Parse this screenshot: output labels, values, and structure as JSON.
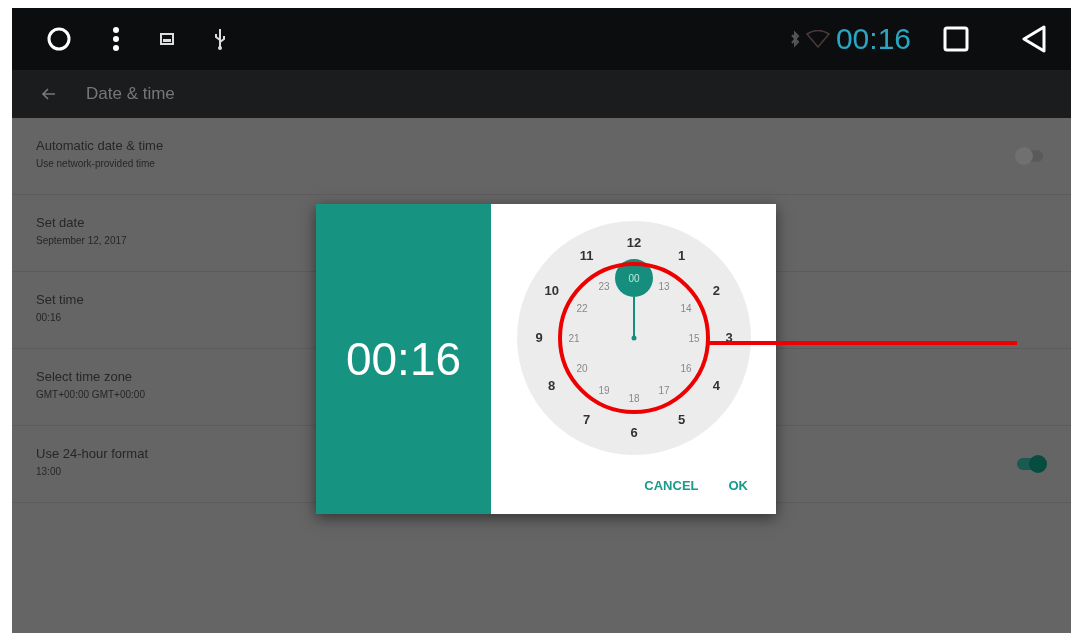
{
  "status_bar": {
    "time": "00:16"
  },
  "toolbar": {
    "title": "Date & time"
  },
  "settings": [
    {
      "title": "Automatic date & time",
      "subtitle": "Use network-provided time",
      "kind": "switch",
      "on": false
    },
    {
      "title": "Set date",
      "subtitle": "September 12, 2017",
      "kind": "plain"
    },
    {
      "title": "Set time",
      "subtitle": "00:16",
      "kind": "plain"
    },
    {
      "title": "Select time zone",
      "subtitle": "GMT+00:00 GMT+00:00",
      "kind": "plain"
    },
    {
      "title": "Use 24-hour format",
      "subtitle": "13:00",
      "kind": "switch",
      "on": true
    }
  ],
  "dialog": {
    "time": "00:16",
    "outer": [
      {
        "label": "12",
        "selected": false
      },
      {
        "label": "1",
        "selected": false
      },
      {
        "label": "2",
        "selected": false
      },
      {
        "label": "3",
        "selected": false
      },
      {
        "label": "4",
        "selected": false
      },
      {
        "label": "5",
        "selected": false
      },
      {
        "label": "6",
        "selected": false
      },
      {
        "label": "7",
        "selected": false
      },
      {
        "label": "8",
        "selected": false
      },
      {
        "label": "9",
        "selected": false
      },
      {
        "label": "10",
        "selected": false
      },
      {
        "label": "11",
        "selected": false
      }
    ],
    "inner": [
      {
        "label": "00",
        "selected": true
      },
      {
        "label": "13",
        "selected": false
      },
      {
        "label": "14",
        "selected": false
      },
      {
        "label": "15",
        "selected": false
      },
      {
        "label": "16",
        "selected": false
      },
      {
        "label": "17",
        "selected": false
      },
      {
        "label": "18",
        "selected": false
      },
      {
        "label": "19",
        "selected": false
      },
      {
        "label": "20",
        "selected": false
      },
      {
        "label": "21",
        "selected": false
      },
      {
        "label": "22",
        "selected": false
      },
      {
        "label": "23",
        "selected": false
      }
    ],
    "buttons": [
      "CANCEL",
      "OK"
    ]
  }
}
